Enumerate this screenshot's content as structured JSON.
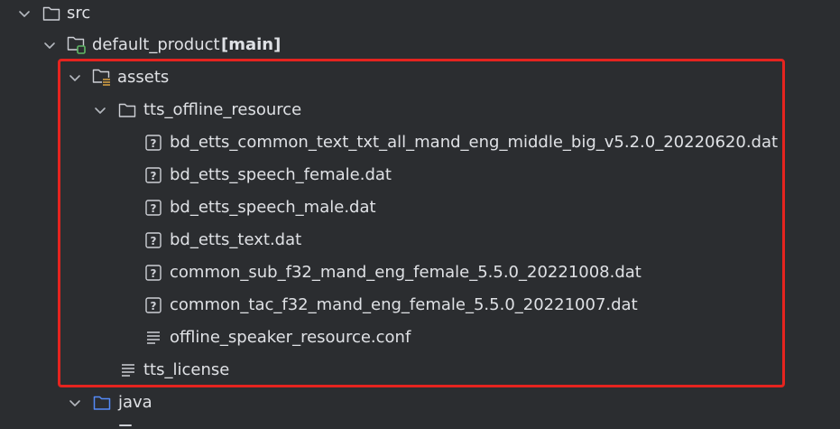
{
  "tree": {
    "src": {
      "label": "src",
      "icon": "folder-icon"
    },
    "default_product": {
      "label": "default_product",
      "branch": "[main]",
      "icon": "module-folder-icon"
    },
    "assets": {
      "label": "assets",
      "icon": "resources-folder-icon"
    },
    "tts_offline_resource": {
      "label": "tts_offline_resource",
      "icon": "folder-icon"
    },
    "files": [
      {
        "label": "bd_etts_common_text_txt_all_mand_eng_middle_big_v5.2.0_20220620.dat",
        "icon": "unknown-file-icon"
      },
      {
        "label": "bd_etts_speech_female.dat",
        "icon": "unknown-file-icon"
      },
      {
        "label": "bd_etts_speech_male.dat",
        "icon": "unknown-file-icon"
      },
      {
        "label": "bd_etts_text.dat",
        "icon": "unknown-file-icon"
      },
      {
        "label": "common_sub_f32_mand_eng_female_5.5.0_20221008.dat",
        "icon": "unknown-file-icon"
      },
      {
        "label": "common_tac_f32_mand_eng_female_5.5.0_20221007.dat",
        "icon": "unknown-file-icon"
      },
      {
        "label": "offline_speaker_resource.conf",
        "icon": "text-file-icon"
      }
    ],
    "tts_license": {
      "label": "tts_license",
      "icon": "text-file-icon"
    },
    "java": {
      "label": "java",
      "icon": "source-folder-icon"
    }
  },
  "colors": {
    "background": "#2b2d30",
    "text": "#dfe1e5",
    "highlight": "#e5241f",
    "source_folder": "#548af7",
    "module_badge": "#5fb865",
    "resources_badge": "#d9a343"
  }
}
